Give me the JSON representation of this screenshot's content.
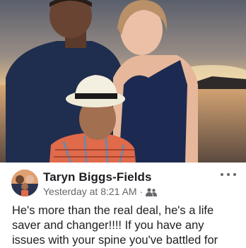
{
  "photo": {
    "description_icon": "family-photo"
  },
  "post": {
    "author": "Taryn Biggs-Fields",
    "timestamp": "Yesterday at 8:21 AM",
    "separator": "·",
    "audience_icon": "friends-icon",
    "more_icon": "more-options-icon",
    "text": "He's more than the real deal, he's a life saver and changer!!!! If you have any issues with your spine you've battled for"
  }
}
